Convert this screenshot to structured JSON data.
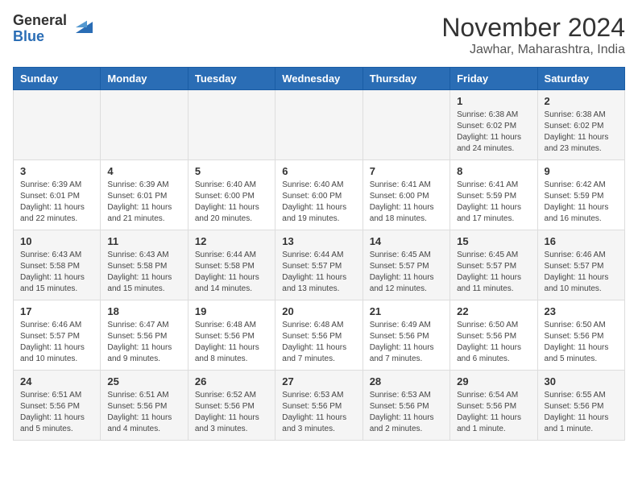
{
  "logo": {
    "general": "General",
    "blue": "Blue"
  },
  "title": "November 2024",
  "location": "Jawhar, Maharashtra, India",
  "days_of_week": [
    "Sunday",
    "Monday",
    "Tuesday",
    "Wednesday",
    "Thursday",
    "Friday",
    "Saturday"
  ],
  "weeks": [
    [
      {
        "day": "",
        "info": ""
      },
      {
        "day": "",
        "info": ""
      },
      {
        "day": "",
        "info": ""
      },
      {
        "day": "",
        "info": ""
      },
      {
        "day": "",
        "info": ""
      },
      {
        "day": "1",
        "info": "Sunrise: 6:38 AM\nSunset: 6:02 PM\nDaylight: 11 hours and 24 minutes."
      },
      {
        "day": "2",
        "info": "Sunrise: 6:38 AM\nSunset: 6:02 PM\nDaylight: 11 hours and 23 minutes."
      }
    ],
    [
      {
        "day": "3",
        "info": "Sunrise: 6:39 AM\nSunset: 6:01 PM\nDaylight: 11 hours and 22 minutes."
      },
      {
        "day": "4",
        "info": "Sunrise: 6:39 AM\nSunset: 6:01 PM\nDaylight: 11 hours and 21 minutes."
      },
      {
        "day": "5",
        "info": "Sunrise: 6:40 AM\nSunset: 6:00 PM\nDaylight: 11 hours and 20 minutes."
      },
      {
        "day": "6",
        "info": "Sunrise: 6:40 AM\nSunset: 6:00 PM\nDaylight: 11 hours and 19 minutes."
      },
      {
        "day": "7",
        "info": "Sunrise: 6:41 AM\nSunset: 6:00 PM\nDaylight: 11 hours and 18 minutes."
      },
      {
        "day": "8",
        "info": "Sunrise: 6:41 AM\nSunset: 5:59 PM\nDaylight: 11 hours and 17 minutes."
      },
      {
        "day": "9",
        "info": "Sunrise: 6:42 AM\nSunset: 5:59 PM\nDaylight: 11 hours and 16 minutes."
      }
    ],
    [
      {
        "day": "10",
        "info": "Sunrise: 6:43 AM\nSunset: 5:58 PM\nDaylight: 11 hours and 15 minutes."
      },
      {
        "day": "11",
        "info": "Sunrise: 6:43 AM\nSunset: 5:58 PM\nDaylight: 11 hours and 15 minutes."
      },
      {
        "day": "12",
        "info": "Sunrise: 6:44 AM\nSunset: 5:58 PM\nDaylight: 11 hours and 14 minutes."
      },
      {
        "day": "13",
        "info": "Sunrise: 6:44 AM\nSunset: 5:57 PM\nDaylight: 11 hours and 13 minutes."
      },
      {
        "day": "14",
        "info": "Sunrise: 6:45 AM\nSunset: 5:57 PM\nDaylight: 11 hours and 12 minutes."
      },
      {
        "day": "15",
        "info": "Sunrise: 6:45 AM\nSunset: 5:57 PM\nDaylight: 11 hours and 11 minutes."
      },
      {
        "day": "16",
        "info": "Sunrise: 6:46 AM\nSunset: 5:57 PM\nDaylight: 11 hours and 10 minutes."
      }
    ],
    [
      {
        "day": "17",
        "info": "Sunrise: 6:46 AM\nSunset: 5:57 PM\nDaylight: 11 hours and 10 minutes."
      },
      {
        "day": "18",
        "info": "Sunrise: 6:47 AM\nSunset: 5:56 PM\nDaylight: 11 hours and 9 minutes."
      },
      {
        "day": "19",
        "info": "Sunrise: 6:48 AM\nSunset: 5:56 PM\nDaylight: 11 hours and 8 minutes."
      },
      {
        "day": "20",
        "info": "Sunrise: 6:48 AM\nSunset: 5:56 PM\nDaylight: 11 hours and 7 minutes."
      },
      {
        "day": "21",
        "info": "Sunrise: 6:49 AM\nSunset: 5:56 PM\nDaylight: 11 hours and 7 minutes."
      },
      {
        "day": "22",
        "info": "Sunrise: 6:50 AM\nSunset: 5:56 PM\nDaylight: 11 hours and 6 minutes."
      },
      {
        "day": "23",
        "info": "Sunrise: 6:50 AM\nSunset: 5:56 PM\nDaylight: 11 hours and 5 minutes."
      }
    ],
    [
      {
        "day": "24",
        "info": "Sunrise: 6:51 AM\nSunset: 5:56 PM\nDaylight: 11 hours and 5 minutes."
      },
      {
        "day": "25",
        "info": "Sunrise: 6:51 AM\nSunset: 5:56 PM\nDaylight: 11 hours and 4 minutes."
      },
      {
        "day": "26",
        "info": "Sunrise: 6:52 AM\nSunset: 5:56 PM\nDaylight: 11 hours and 3 minutes."
      },
      {
        "day": "27",
        "info": "Sunrise: 6:53 AM\nSunset: 5:56 PM\nDaylight: 11 hours and 3 minutes."
      },
      {
        "day": "28",
        "info": "Sunrise: 6:53 AM\nSunset: 5:56 PM\nDaylight: 11 hours and 2 minutes."
      },
      {
        "day": "29",
        "info": "Sunrise: 6:54 AM\nSunset: 5:56 PM\nDaylight: 11 hours and 1 minute."
      },
      {
        "day": "30",
        "info": "Sunrise: 6:55 AM\nSunset: 5:56 PM\nDaylight: 11 hours and 1 minute."
      }
    ]
  ]
}
